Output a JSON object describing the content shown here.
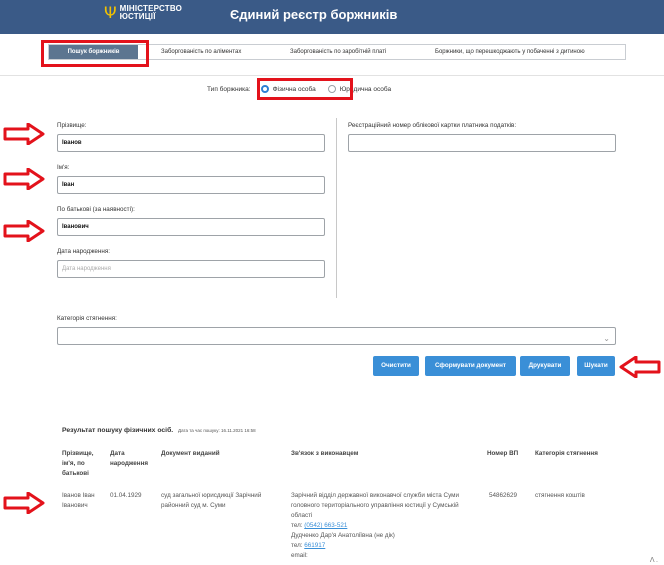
{
  "header": {
    "logo_line1": "МІНІСТЕРСТВО",
    "logo_line2": "ЮСТИЦІЇ",
    "title": "Єдиний реєстр боржників"
  },
  "tabs": [
    {
      "label": "Пошук боржників",
      "active": true
    },
    {
      "label": "Заборгованість по аліментах",
      "active": false
    },
    {
      "label": "Заборгованість по заробітній платі",
      "active": false
    },
    {
      "label": "Боржники, що перешкоджають у побаченні з дитиною",
      "active": false
    }
  ],
  "debtor_type": {
    "label": "Тип боржника:",
    "options": [
      "Фізична особа",
      "Юридична особа"
    ],
    "selected": "Фізична особа"
  },
  "form": {
    "surname": {
      "label": "Прізвище:",
      "value": "Іванов"
    },
    "name": {
      "label": "Ім'я:",
      "value": "Іван"
    },
    "patronymic": {
      "label": "По батькові (за наявності):",
      "value": "Іванович"
    },
    "birthdate": {
      "label": "Дата народження:",
      "placeholder": "Дата народження"
    },
    "tax_number": {
      "label": "Реєстраційний номер облікової картки платника податків:",
      "value": ""
    },
    "category": {
      "label": "Категорія стягнення:",
      "value": ""
    }
  },
  "buttons": {
    "clear": "Очистити",
    "generate": "Сформувати документ",
    "print": "Друкувати",
    "search": "Шукати"
  },
  "results": {
    "title": "Результат пошуку фізичних осіб.",
    "timestamp": "Дата та час пошуку: 16.11.2021 16:58",
    "headers": {
      "name": [
        "Прізвище,",
        "ім'я, по",
        "батькові"
      ],
      "birthdate": [
        "Дата",
        "народження"
      ],
      "issued_by": "Документ виданий",
      "contact": "Зв'язок з виконавцем",
      "vp_number": "Номер ВП",
      "category": "Категорія стягнення"
    },
    "row": {
      "name": [
        "Іванов Іван",
        "Іванович"
      ],
      "birthdate": "01.04.1929",
      "issued_by": [
        "суд загальної юрисдикції Зарічний",
        "районний суд м. Суми"
      ],
      "contact_office": [
        "Зарічний відділ державної виконавчої служби міста Суми",
        "головного територіального управління юстиції у Сумській",
        "області"
      ],
      "contact_tel1_label": "тел:",
      "contact_tel1": "(0542) 663-521",
      "contact_person": "Дудченко Дар'я Анатоліївна (не дік)",
      "contact_tel2_label": "тел:",
      "contact_tel2": "661917",
      "contact_email_label": "email:",
      "vp_number": "54862629",
      "category": "стягнення коштів"
    }
  },
  "corner_mark": "Λ .",
  "colors": {
    "header_bg": "#3a5a87",
    "accent": "#3a8fd7",
    "highlight": "#e3121b"
  }
}
